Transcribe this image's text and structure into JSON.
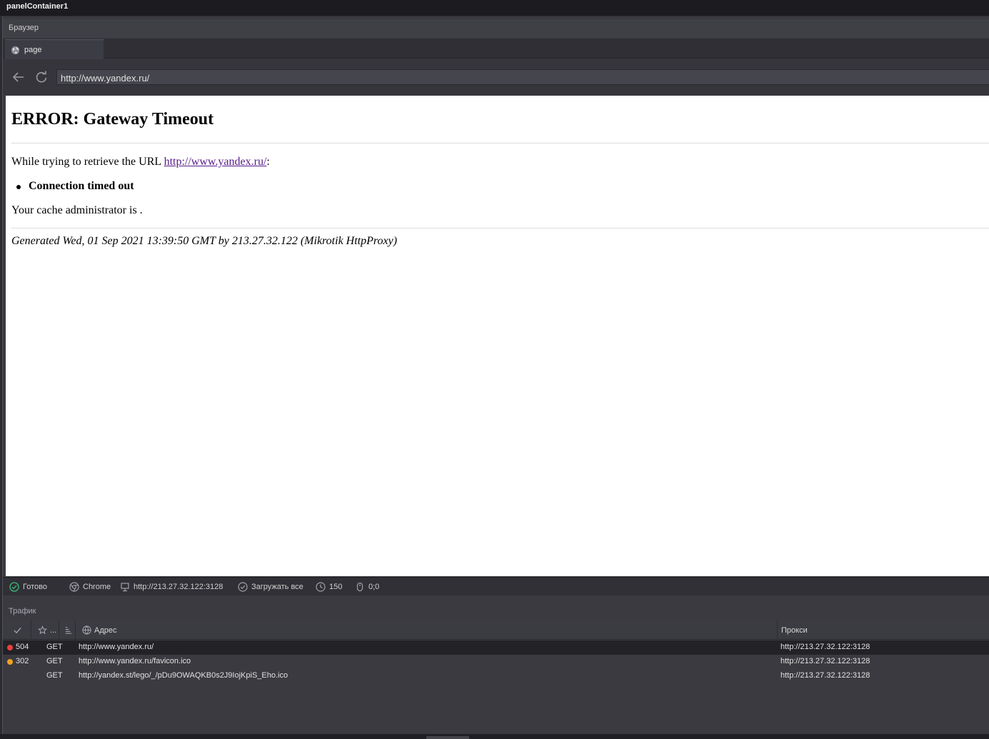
{
  "window": {
    "title": "panelContainer1"
  },
  "browser_panel": {
    "title": "Браузер"
  },
  "tab": {
    "label": "page"
  },
  "navigation": {
    "url": "http://www.yandex.ru/"
  },
  "page": {
    "heading": "ERROR: Gateway Timeout",
    "retrieve_prefix": "While trying to retrieve the URL ",
    "retrieve_link": "http://www.yandex.ru/",
    "retrieve_suffix": ":",
    "bullet": "Connection timed out",
    "admin_line": "Your cache administrator is .",
    "generated": "Generated Wed, 01 Sep 2021 13:39:50 GMT by 213.27.32.122 (Mikrotik HttpProxy)"
  },
  "status": {
    "state": "Готово",
    "engine": "Chrome",
    "proxy": "http://213.27.32.122:3128",
    "load_mode": "Загружать все",
    "timeout": "150",
    "mouse": "0;0"
  },
  "traffic": {
    "title": "Трафик",
    "columns": {
      "flag": "...",
      "address": "Адрес",
      "proxy": "Прокси"
    },
    "rows": [
      {
        "status": "504",
        "method": "GET",
        "url": "http://www.yandex.ru/",
        "proxy": "http://213.27.32.122:3128",
        "dot_color": "#e8413c"
      },
      {
        "status": "302",
        "method": "GET",
        "url": "http://www.yandex.ru/favicon.ico",
        "proxy": "http://213.27.32.122:3128",
        "dot_color": "#f0a21c"
      },
      {
        "status": "",
        "method": "GET",
        "url": "http://yandex.st/lego/_/pDu9OWAQKB0s2J9IojKpiS_Eho.ico",
        "proxy": "http://213.27.32.122:3128",
        "dot_color": ""
      }
    ]
  },
  "colors": {
    "ok_green": "#3dbb78",
    "link_visited": "#551a8b"
  }
}
